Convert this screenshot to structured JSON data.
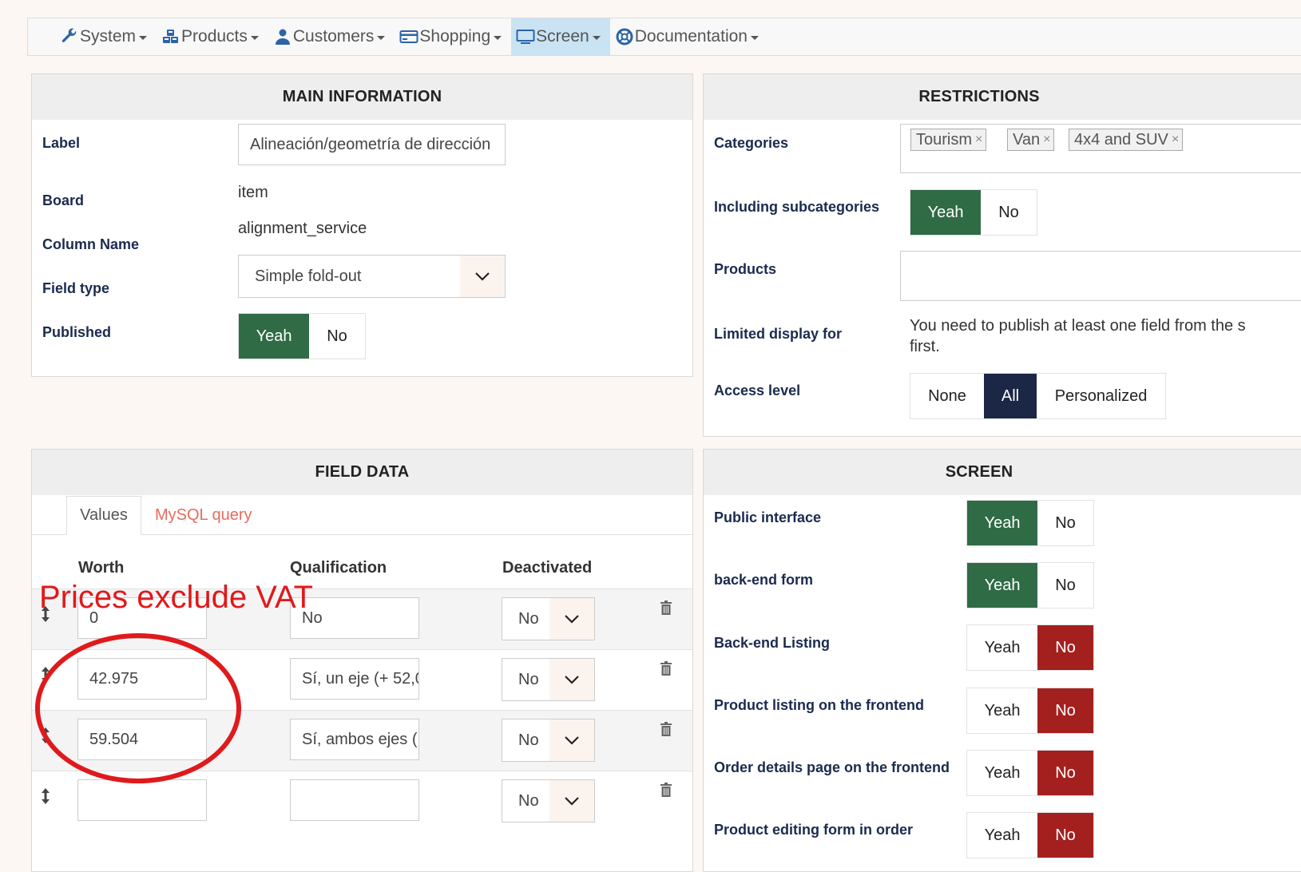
{
  "nav": {
    "items": [
      {
        "label": "System",
        "icon": "wrench-icon"
      },
      {
        "label": "Products",
        "icon": "cubes-icon"
      },
      {
        "label": "Customers",
        "icon": "user-icon"
      },
      {
        "label": "Shopping",
        "icon": "credit-card-icon"
      },
      {
        "label": "Screen",
        "icon": "monitor-icon",
        "active": true
      },
      {
        "label": "Documentation",
        "icon": "lifebuoy-icon"
      }
    ]
  },
  "main_info": {
    "title": "MAIN INFORMATION",
    "label_label": "Label",
    "label_value": "Alineación/geometría de dirección",
    "board_label": "Board",
    "board_value": "item",
    "column_label": "Column Name",
    "column_value": "alignment_service",
    "field_type_label": "Field type",
    "field_type_value": "Simple fold-out",
    "published_label": "Published",
    "published_yes": "Yeah",
    "published_no": "No"
  },
  "restrictions": {
    "title": "RESTRICTIONS",
    "categories_label": "Categories",
    "tags": [
      "Tourism",
      "Van",
      "4x4 and SUV"
    ],
    "tag_remove": "×",
    "subcat_label": "Including subcategories",
    "subcat_yes": "Yeah",
    "subcat_no": "No",
    "products_label": "Products",
    "limited_label": "Limited display for",
    "limited_text_1": "You need to publish at least one field from the s",
    "limited_text_2": "first.",
    "access_label": "Access level",
    "access_none": "None",
    "access_all": "All",
    "access_personalized": "Personalized"
  },
  "field_data": {
    "title": "FIELD DATA",
    "tab_values": "Values",
    "tab_mysql": "MySQL query",
    "col_worth": "Worth",
    "col_qualification": "Qualification",
    "col_deactivated": "Deactivated",
    "rows": [
      {
        "worth": "0",
        "qualification": "No",
        "deactivated": "No"
      },
      {
        "worth": "42.975",
        "qualification": "Sí, un eje (+ 52,0",
        "deactivated": "No"
      },
      {
        "worth": "59.504",
        "qualification": "Sí, ambos ejes (",
        "deactivated": "No"
      },
      {
        "worth": "",
        "qualification": "",
        "deactivated": "No"
      }
    ]
  },
  "screen": {
    "title": "SCREEN",
    "rows": [
      {
        "label": "Public interface",
        "yes": "Yeah",
        "no": "No",
        "value": "yes"
      },
      {
        "label": "back-end form",
        "yes": "Yeah",
        "no": "No",
        "value": "yes"
      },
      {
        "label": "Back-end Listing",
        "yes": "Yeah",
        "no": "No",
        "value": "no"
      },
      {
        "label": "Product listing on the frontend",
        "yes": "Yeah",
        "no": "No",
        "value": "no"
      },
      {
        "label": "Order details page on the frontend",
        "yes": "Yeah",
        "no": "No",
        "value": "no"
      },
      {
        "label": "Product editing form in order",
        "yes": "Yeah",
        "no": "No",
        "value": "no"
      }
    ]
  },
  "annotation": {
    "text": "Prices exclude VAT",
    "color": "#e0191b"
  },
  "colors": {
    "yes_active": "#2f6b45",
    "no_active": "#a3201f",
    "all_active": "#1b2745",
    "label_text": "#1b2a4e",
    "tab_link": "#e96a5f",
    "nav_active": "#c9e3f2"
  }
}
